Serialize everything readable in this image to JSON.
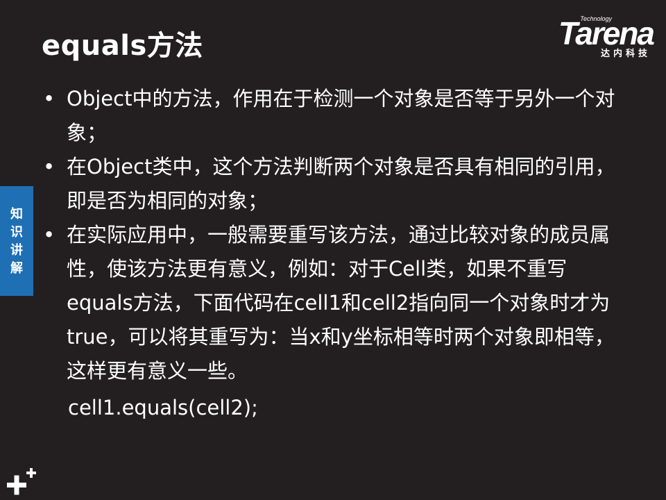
{
  "slide": {
    "title": "equals方法",
    "logo": {
      "small": "Technology",
      "main": "Tarena",
      "cn": "达内科技"
    },
    "side_tab": [
      "知",
      "识",
      "讲",
      "解"
    ],
    "bullets": [
      {
        "symbol": "•",
        "text": "Object中的方法，作用在于检测一个对象是否等于另外一个对象；"
      },
      {
        "symbol": "•",
        "text": "在Object类中，这个方法判断两个对象是否具有相同的引用，即是否为相同的对象；"
      },
      {
        "symbol": "•",
        "text": "在实际应用中，一般需要重写该方法，通过比较对象的成员属性，使该方法更有意义，例如：对于Cell类，如果不重写equals方法，下面代码在cell1和cell2指向同一个对象时才为true，可以将其重写为：当x和y坐标相等时两个对象即相等，这样更有意义一些。"
      }
    ],
    "code": "cell1.equals(cell2);"
  },
  "colors": {
    "background": "#231f20",
    "text": "#ffffff",
    "side_tab": "#1f6fb5"
  }
}
